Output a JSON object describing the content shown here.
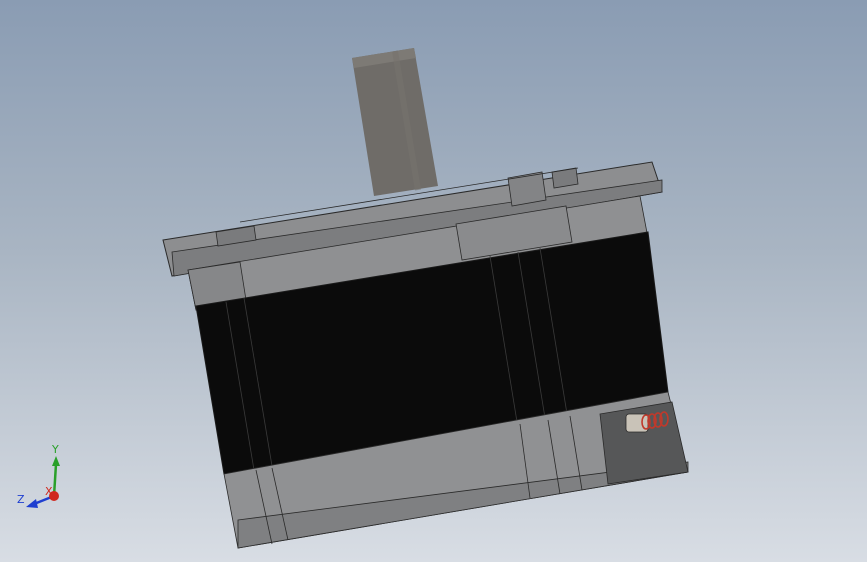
{
  "viewport": {
    "background_top": "#8a9cb3",
    "background_bottom": "#d8dde4"
  },
  "model": {
    "shaft_color": "#6e6b66",
    "flange_color": "#8b8c8e",
    "body_color": "#0a0a0a",
    "end_cap_color": "#8e8f91",
    "connector_color": "#555657",
    "spring_color": "#c0392b"
  },
  "triad": {
    "x_label": "X",
    "y_label": "Y",
    "z_label": "Z",
    "x_color": "#d0281e",
    "y_color": "#2aa02a",
    "z_color": "#1f3fd0"
  }
}
